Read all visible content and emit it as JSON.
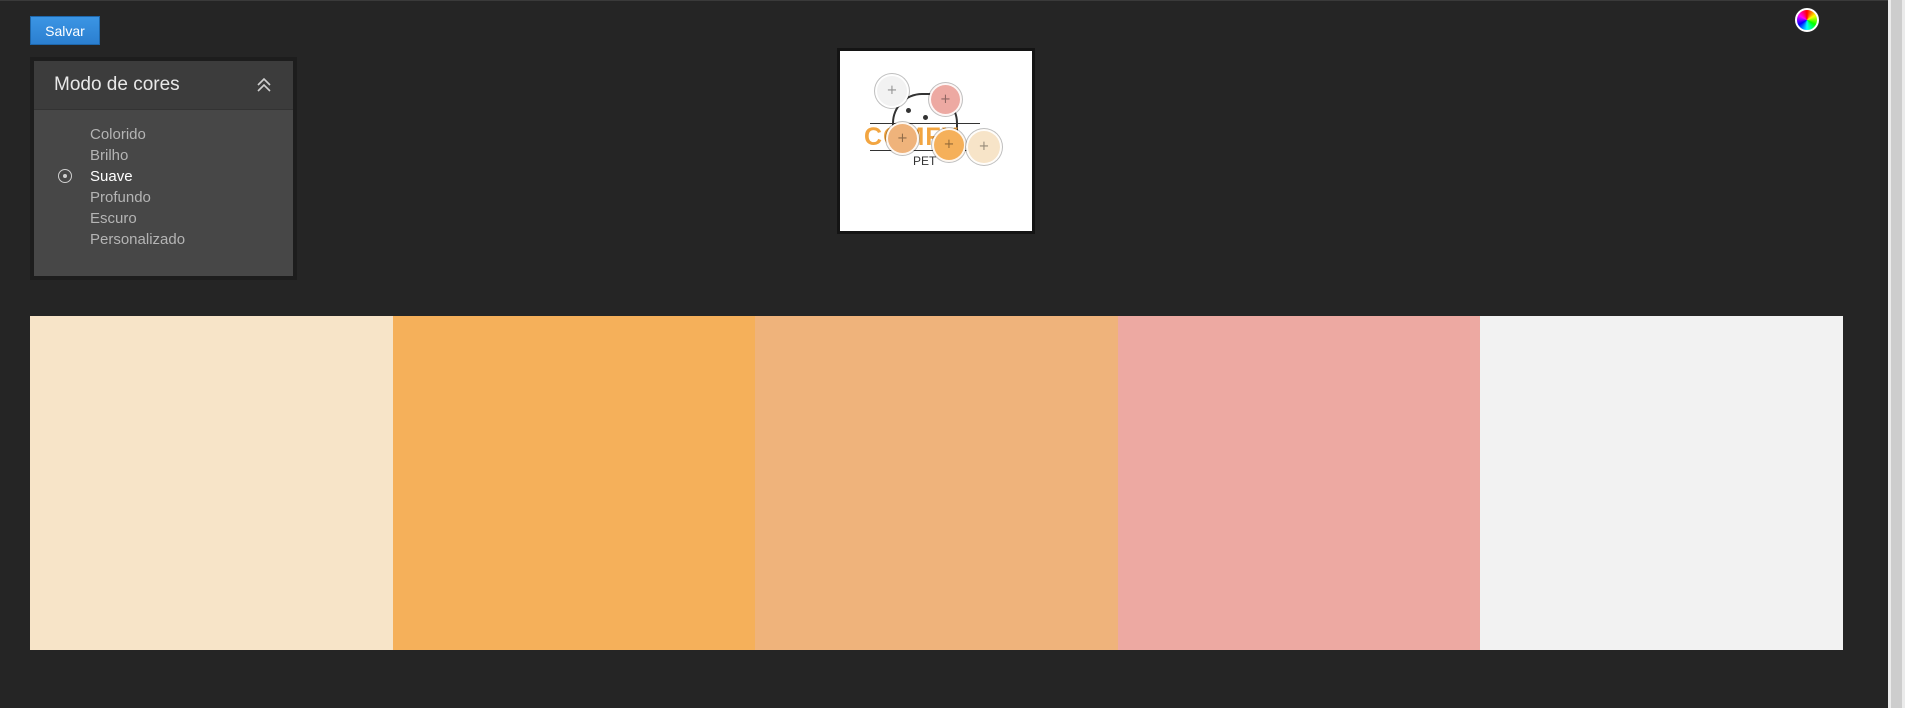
{
  "toolbar": {
    "save_label": "Salvar"
  },
  "color_mode_panel": {
    "title": "Modo de cores",
    "modes": [
      "Colorido",
      "Brilho",
      "Suave",
      "Profundo",
      "Escuro",
      "Personalizado"
    ],
    "selected_mode": "Suave"
  },
  "logo": {
    "text": "COMFY",
    "subtext": "PET"
  },
  "palette": {
    "colors": [
      "#F7E4C8",
      "#F5B05A",
      "#EFB37B",
      "#EDA9A2",
      "#F2F2F2"
    ]
  },
  "icons": {
    "color_wheel": "color-wheel-icon",
    "collapse": "double-chevron-up-icon",
    "radio": "radio-selected-icon"
  }
}
